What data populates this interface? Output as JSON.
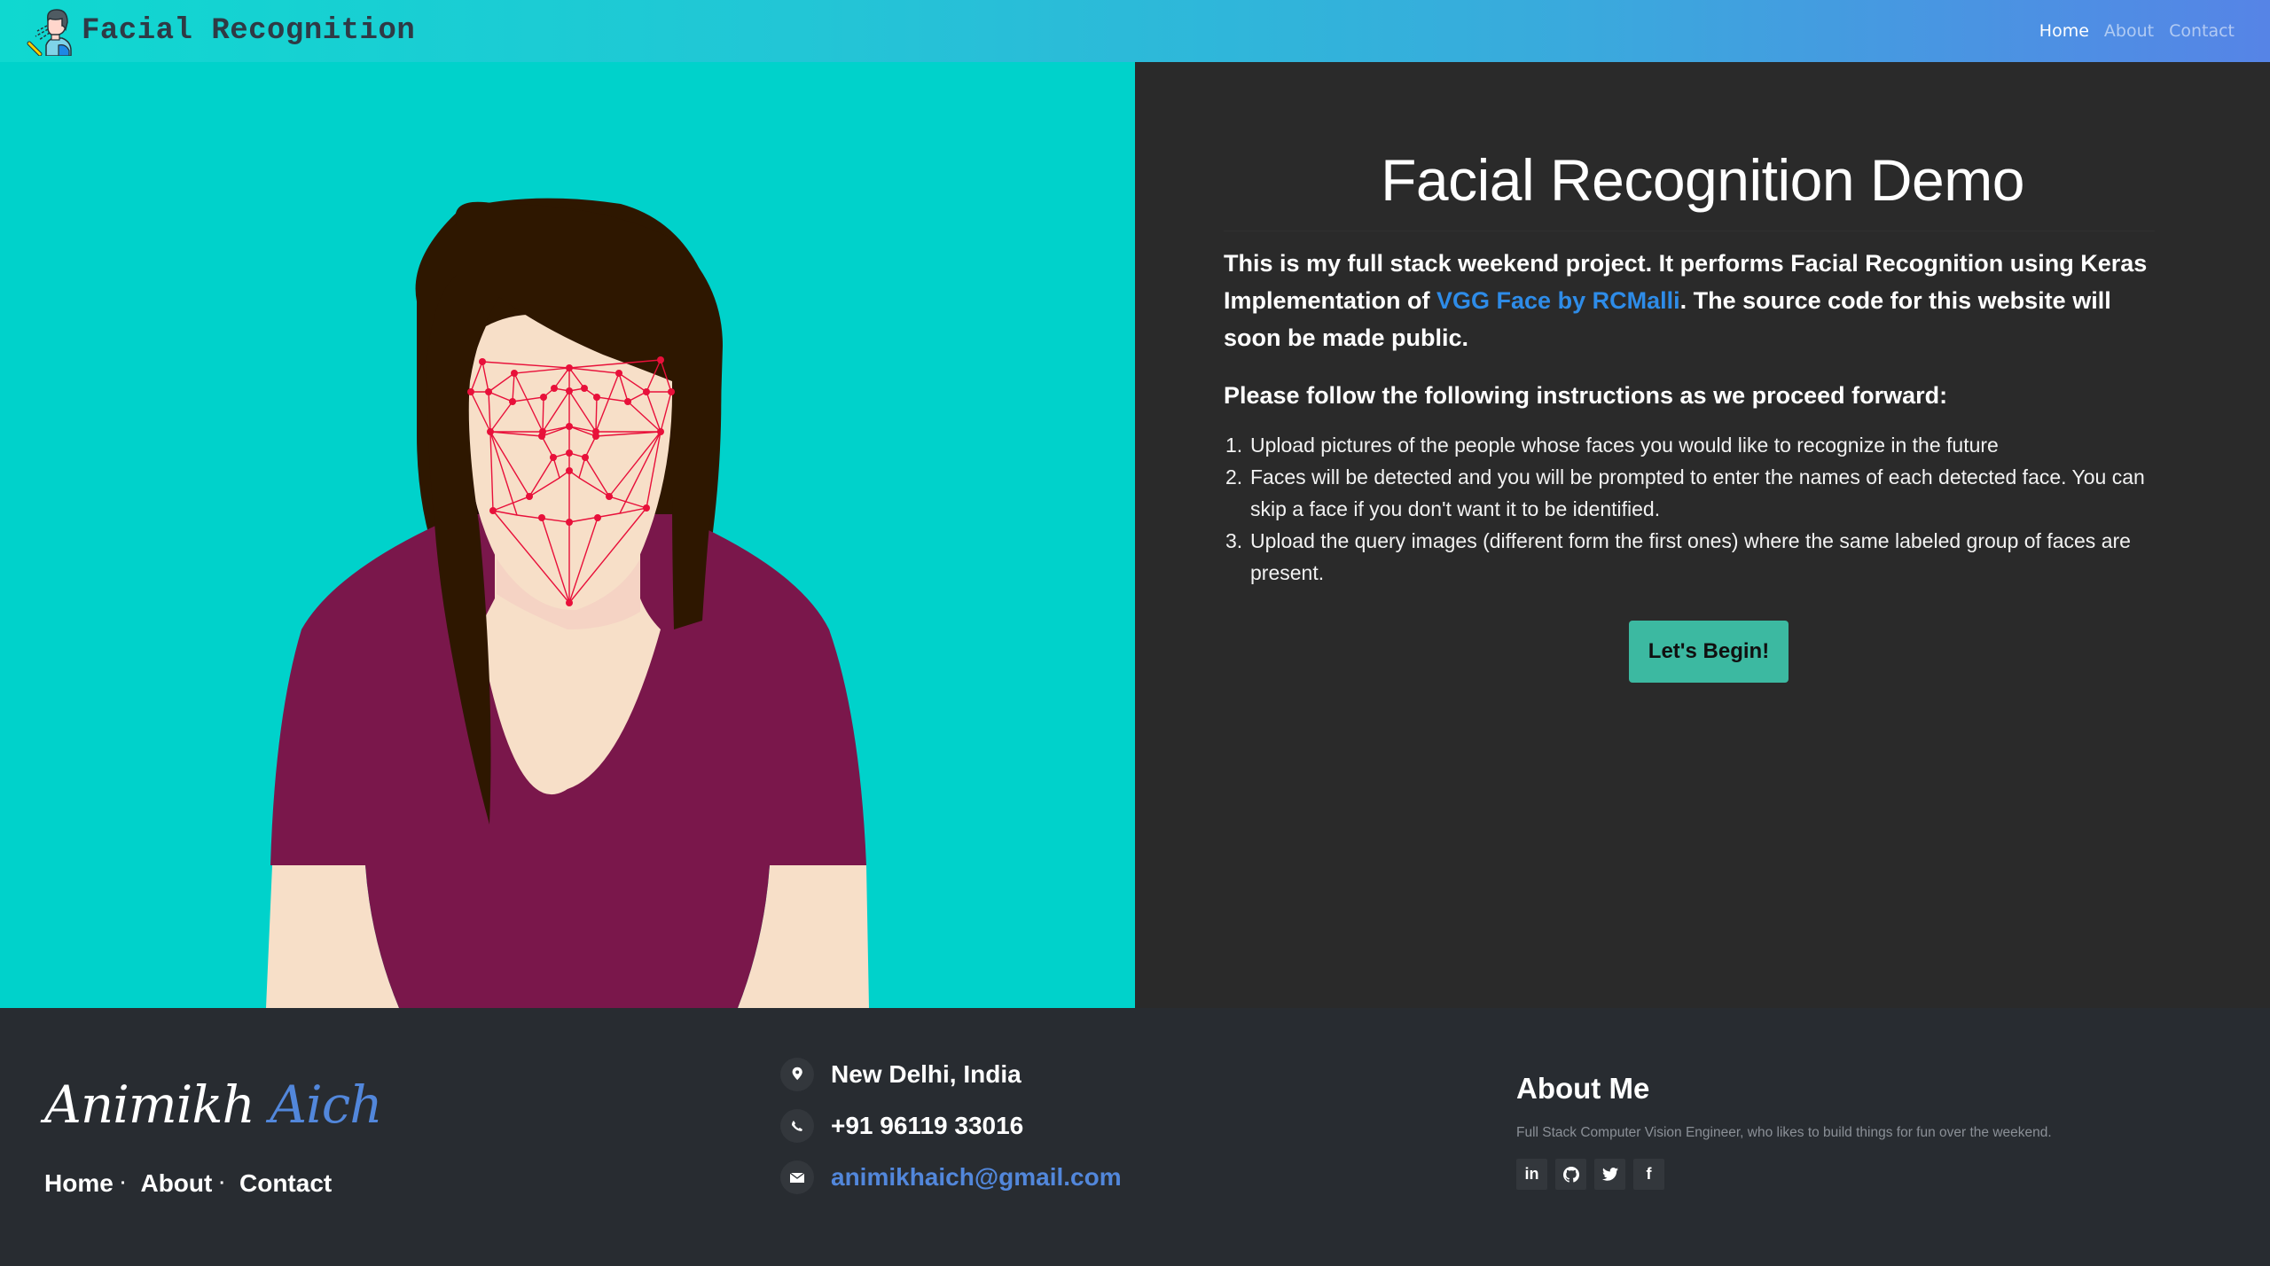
{
  "header": {
    "brand_title": "Facial Recognition",
    "logo_icon": "face-scan-person-icon",
    "nav": [
      {
        "label": "Home",
        "active": true
      },
      {
        "label": "About",
        "active": false
      },
      {
        "label": "Contact",
        "active": false
      }
    ]
  },
  "hero": {
    "illustration": "woman-face-mesh-illustration",
    "background_color": "#00d2cb"
  },
  "intro": {
    "title": "Facial Recognition Demo",
    "description_part1": "This is my full stack weekend project. It performs Facial Recognition using Keras Implementation of ",
    "description_link": "VGG Face by RCMalli",
    "description_part2": ". The source code for this website will soon be made public.",
    "instructions_heading": "Please follow the following instructions as we proceed forward:",
    "steps": [
      {
        "number": "1.",
        "text": "Upload pictures of the people whose faces you would like to recognize in the future"
      },
      {
        "number": "2.",
        "text": "Faces will be detected and you will be prompted to enter the names of each detected face. You can skip a face if you don't want it to be identified."
      },
      {
        "number": "3.",
        "text": "Upload the query images (different form the first ones) where the same labeled group of faces are present."
      }
    ],
    "begin_button": "Let's Begin!",
    "accent_color": "#3cb9a1",
    "link_color": "#2e8ce8"
  },
  "footer": {
    "name_first": "Animikh",
    "name_last": "Aich",
    "links": [
      {
        "label": "Home",
        "separator": "·"
      },
      {
        "label": "About",
        "separator": "·"
      },
      {
        "label": "Contact",
        "separator": ""
      }
    ],
    "contact": [
      {
        "icon": "map-pin-icon",
        "text": "New Delhi, India"
      },
      {
        "icon": "phone-icon",
        "text": "+91 96119 33016"
      },
      {
        "icon": "envelope-icon",
        "text": "animikhaich@gmail.com"
      }
    ],
    "about_title": "About Me",
    "about_description": "Full Stack Computer Vision Engineer, who likes to build things for fun over the weekend.",
    "socials": [
      {
        "name": "linkedin",
        "glyph": "in"
      },
      {
        "name": "github",
        "glyph": ""
      },
      {
        "name": "twitter",
        "glyph": ""
      },
      {
        "name": "facebook",
        "glyph": "f"
      }
    ]
  }
}
